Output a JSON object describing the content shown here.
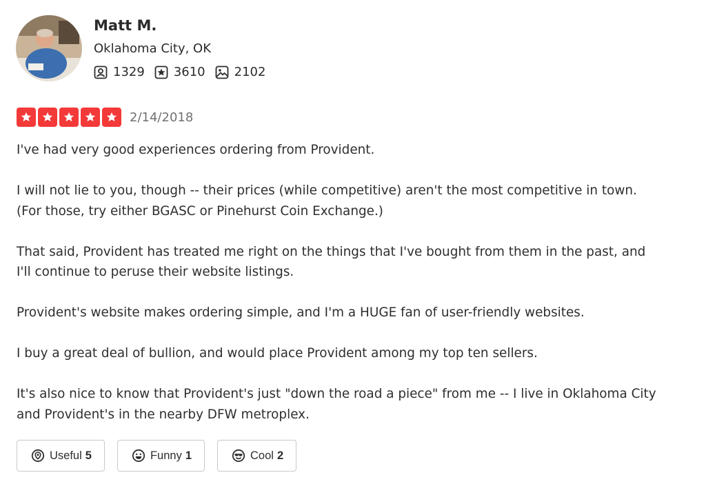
{
  "user": {
    "name": "Matt M.",
    "location": "Oklahoma City, OK",
    "stats": [
      {
        "icon": "friends-icon",
        "value": "1329"
      },
      {
        "icon": "reviews-star-icon",
        "value": "3610"
      },
      {
        "icon": "photos-icon",
        "value": "2102"
      }
    ]
  },
  "review": {
    "rating": 5,
    "rating_max": 5,
    "date": "2/14/2018",
    "paragraphs": [
      [
        "I've had very good experiences ordering from Provident."
      ],
      [
        "I will not lie to you, though -- their prices (while competitive) aren't the most competitive in town.",
        "(For those, try either BGASC or Pinehurst Coin Exchange.)"
      ],
      [
        "That said, Provident has treated me right on the things that I've bought from them in the past, and",
        "I'll continue to peruse their website listings."
      ],
      [
        "Provident's website makes ordering simple, and I'm a HUGE fan of user-friendly websites."
      ],
      [
        "I buy a great deal of bullion, and would place Provident among my top ten sellers."
      ],
      [
        "It's also nice to know that Provident's just \"down the road a piece\" from me -- I live in Oklahoma City",
        "and Provident's in the nearby DFW metroplex."
      ]
    ]
  },
  "reactions": [
    {
      "icon": "useful-icon",
      "label": "Useful",
      "count": "5"
    },
    {
      "icon": "funny-icon",
      "label": "Funny",
      "count": "1"
    },
    {
      "icon": "cool-icon",
      "label": "Cool",
      "count": "2"
    }
  ],
  "colors": {
    "star_red": "#f43939",
    "text": "#2d2e2f",
    "date_gray": "#6e7072",
    "border": "#c8c9ca"
  }
}
